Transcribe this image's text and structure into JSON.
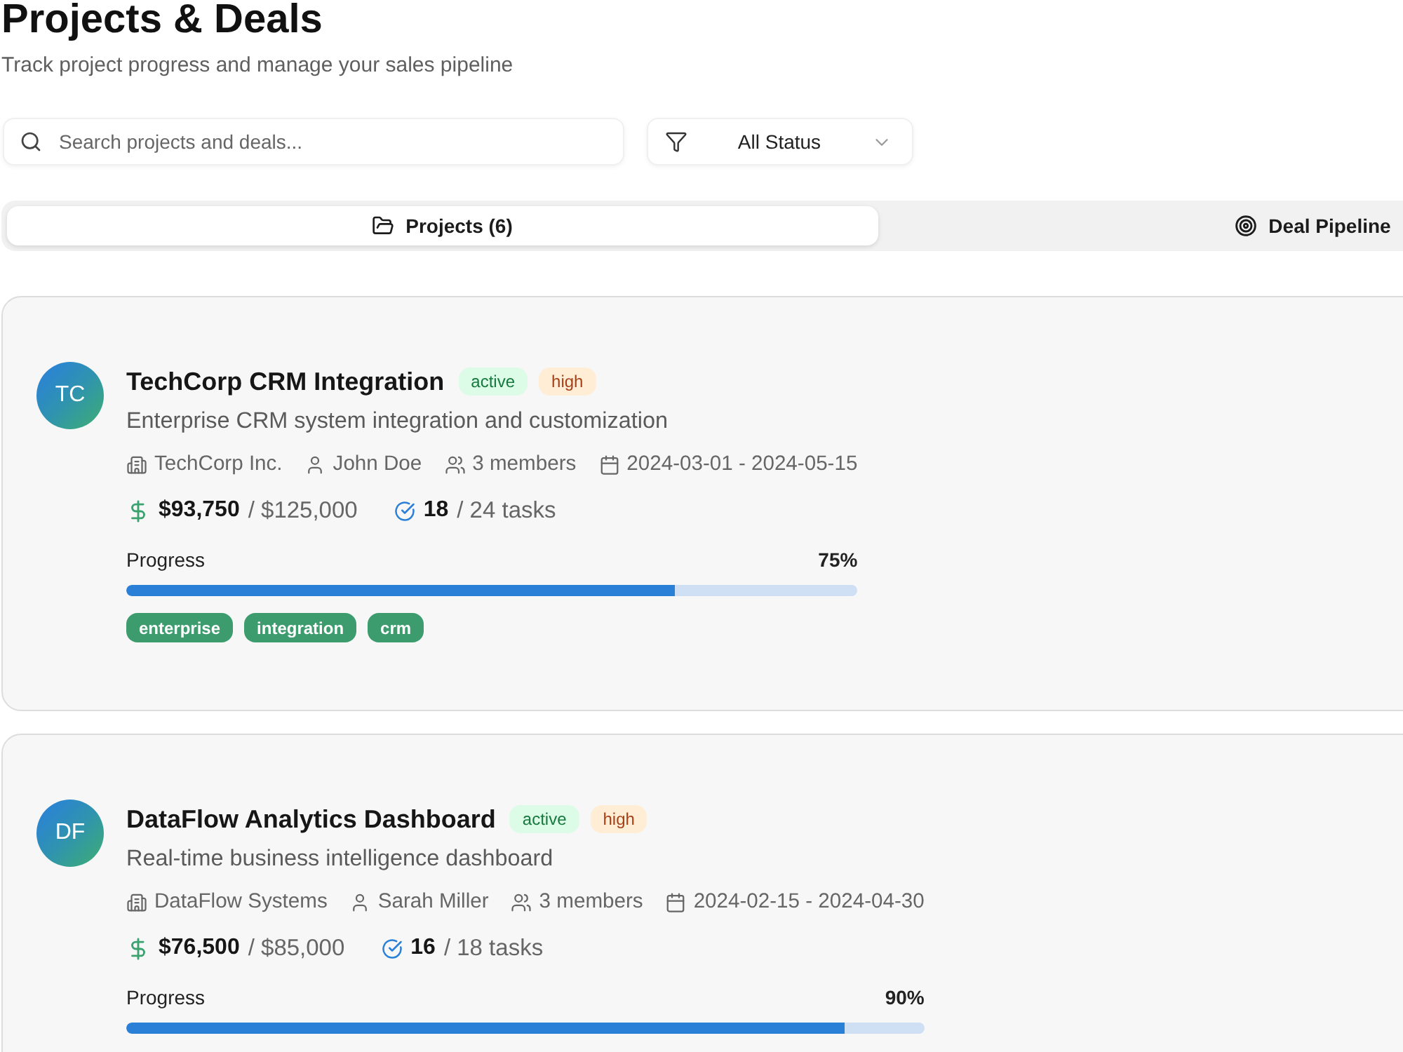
{
  "header": {
    "title": "Projects & Deals",
    "subtitle": "Track project progress and manage your sales pipeline"
  },
  "search": {
    "placeholder": "Search projects and deals..."
  },
  "status_filter": {
    "value": "All Status"
  },
  "tabs": [
    {
      "label": "Projects (6)",
      "kind": "folder",
      "selected": true
    },
    {
      "label": "Deal Pipeline",
      "kind": "target",
      "selected": false
    }
  ],
  "projects": [
    {
      "initials": "TC",
      "name": "TechCorp CRM Integration",
      "badges": [
        {
          "kind": "status",
          "label": "active"
        },
        {
          "kind": "priority",
          "label": "high"
        }
      ],
      "description": "Enterprise CRM system integration and customization",
      "company": "TechCorp Inc.",
      "owner": "John Doe",
      "members": "3 members",
      "dates": "2024-03-01 - 2024-05-15",
      "spent": "$93,750",
      "budget": "/ $125,000",
      "tasks_done": "18",
      "tasks_total": "/ 24 tasks",
      "progress_label": "Progress",
      "progress_text": "75%",
      "level": 0.75,
      "tags": [
        "enterprise",
        "integration",
        "crm"
      ]
    },
    {
      "initials": "DF",
      "name": "DataFlow Analytics Dashboard",
      "badges": [
        {
          "kind": "status",
          "label": "active"
        },
        {
          "kind": "priority",
          "label": "high"
        }
      ],
      "description": "Real-time business intelligence dashboard",
      "company": "DataFlow Systems",
      "owner": "Sarah Miller",
      "members": "3 members",
      "dates": "2024-02-15 - 2024-04-30",
      "spent": "$76,500",
      "budget": "/ $85,000",
      "tasks_done": "16",
      "tasks_total": "/ 18 tasks",
      "progress_label": "Progress",
      "progress_text": "90%",
      "level": 0.9
    }
  ]
}
